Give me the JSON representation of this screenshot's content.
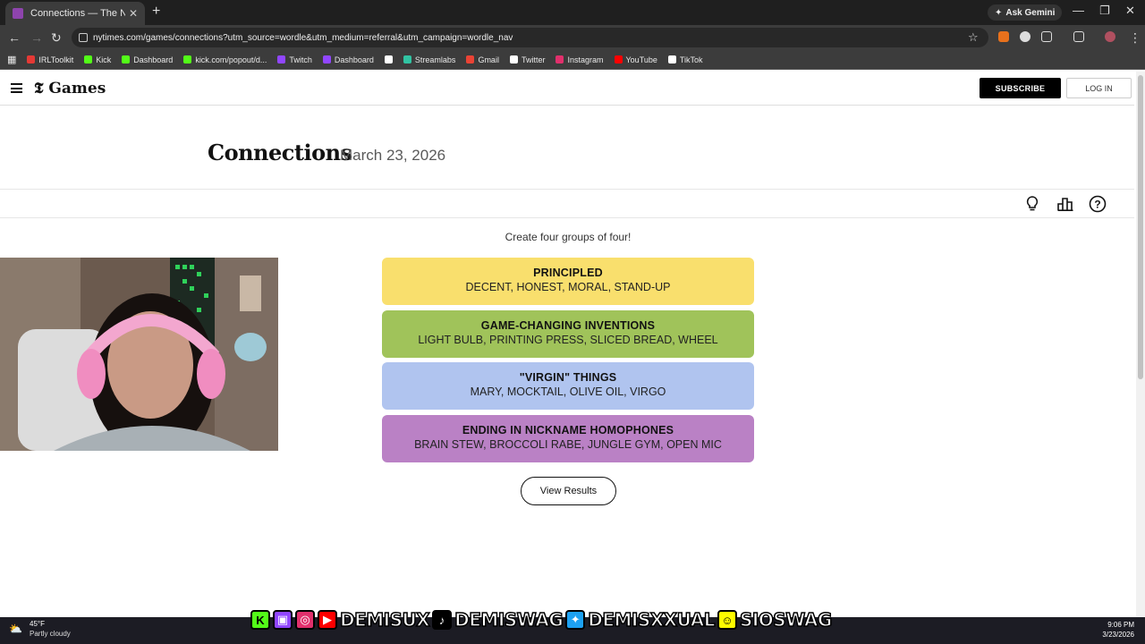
{
  "browser": {
    "tab_title": "Connections — The New York",
    "ask_gemini": "Ask Gemini",
    "url": "nytimes.com/games/connections?utm_source=wordle&utm_medium=referral&utm_campaign=wordle_nav",
    "bookmarks": [
      {
        "label": "IRLToolkit",
        "color": "#e53935"
      },
      {
        "label": "Kick",
        "color": "#53fc18"
      },
      {
        "label": "Dashboard",
        "color": "#53fc18"
      },
      {
        "label": "kick.com/popout/d...",
        "color": "#53fc18"
      },
      {
        "label": "Twitch",
        "color": "#9146ff"
      },
      {
        "label": "Dashboard",
        "color": "#9146ff"
      },
      {
        "label": "",
        "color": "#ffffff"
      },
      {
        "label": "Streamlabs",
        "color": "#31c3a2"
      },
      {
        "label": "Gmail",
        "color": "#ea4335"
      },
      {
        "label": "Twitter",
        "color": "#ffffff"
      },
      {
        "label": "Instagram",
        "color": "#e1306c"
      },
      {
        "label": "YouTube",
        "color": "#ff0000"
      },
      {
        "label": "TikTok",
        "color": "#ffffff"
      }
    ]
  },
  "header": {
    "logo": "Games",
    "subscribe": "SUBSCRIBE",
    "login": "LOG IN"
  },
  "game": {
    "title": "Connections",
    "date": "March 23, 2026",
    "instructions": "Create four groups of four!",
    "groups": [
      {
        "title": "PRINCIPLED",
        "members": "DECENT, HONEST, MORAL, STAND-UP",
        "color": "#f9df6d"
      },
      {
        "title": "GAME-CHANGING INVENTIONS",
        "members": "LIGHT BULB, PRINTING PRESS, SLICED BREAD, WHEEL",
        "color": "#a0c35a"
      },
      {
        "title": "\"VIRGIN\" THINGS",
        "members": "MARY, MOCKTAIL, OLIVE OIL, VIRGO",
        "color": "#b0c4ef"
      },
      {
        "title": "ENDING IN NICKNAME HOMOPHONES",
        "members": "BRAIN STEW, BROCCOLI RABE, JUNGLE GYM, OPEN MIC",
        "color": "#ba81c5"
      }
    ],
    "view_results": "View Results"
  },
  "overlay": {
    "handles": [
      "DEMISUX",
      "DEMISWAG",
      "DEMISXXUAL",
      "SIOSWAG"
    ]
  },
  "taskbar": {
    "temp": "45°F",
    "weather": "Partly cloudy",
    "time": "9:06 PM",
    "date": "3/23/2026"
  }
}
